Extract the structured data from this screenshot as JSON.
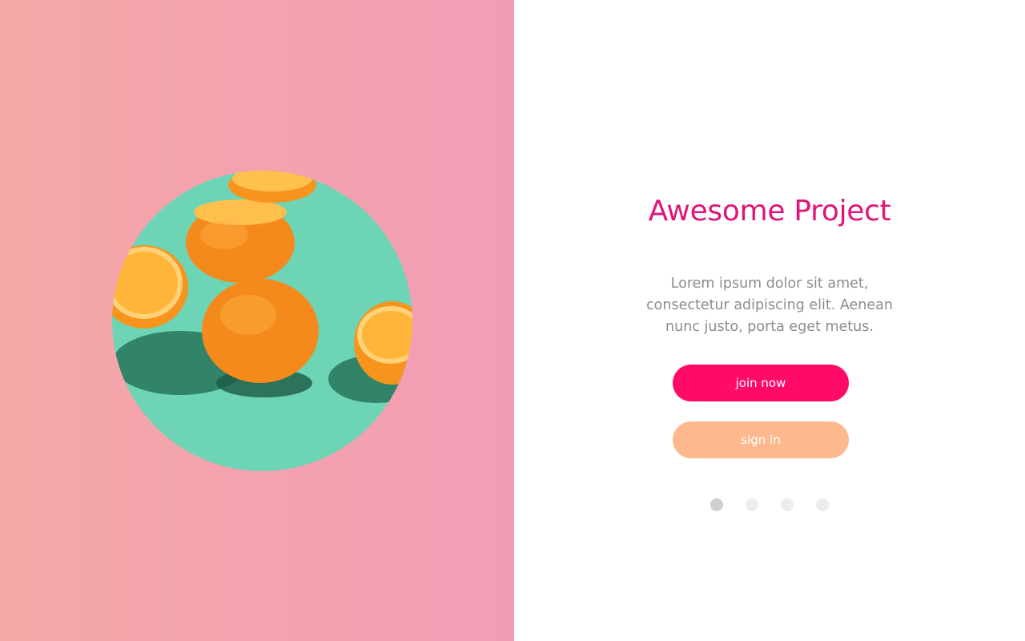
{
  "hero": {
    "image_alt": "Oranges on green background",
    "background_colors": [
      "#f5a7a6",
      "#f29db6"
    ],
    "circle_background": "#6dd4b5"
  },
  "content": {
    "title": "Awesome Project",
    "title_color": "#e0157a",
    "description_lines": [
      "Lorem ipsum dolor sit amet,",
      "consectetur adipiscing elit. Aenean",
      "nunc justo, porta eget metus."
    ]
  },
  "buttons": {
    "join": {
      "label": "join now",
      "color": "#ff0a66"
    },
    "signin": {
      "label": "sign in",
      "color": "#fdb98d"
    }
  },
  "pagination": {
    "count": 4,
    "active_index": 0,
    "active_color": "#cfcfcf",
    "inactive_color": "#ececec"
  }
}
